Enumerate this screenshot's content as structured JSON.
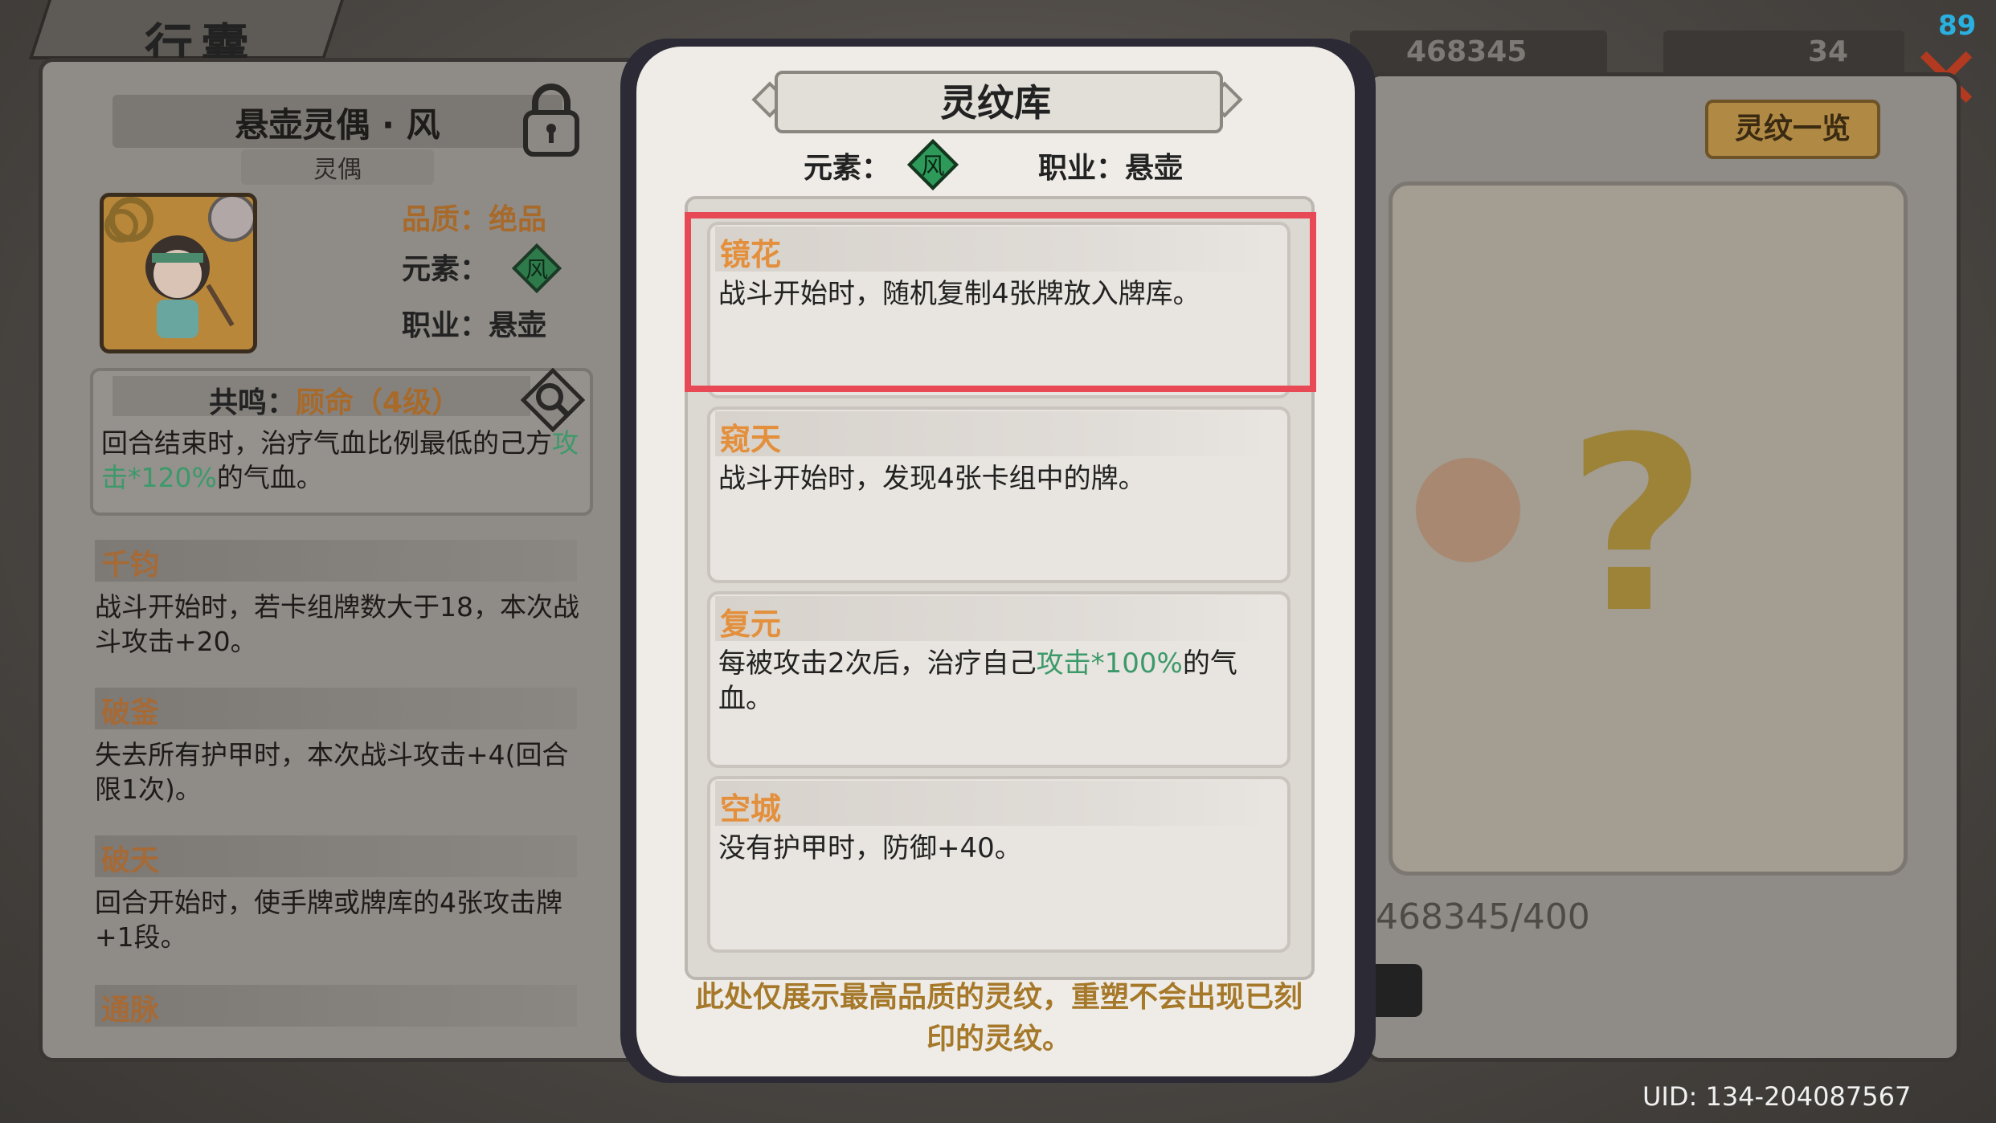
{
  "header": {
    "title": "行囊",
    "currency_1": "468345",
    "currency_2": "34",
    "level_badge": "89"
  },
  "character": {
    "name": "悬壶灵偶 · 风",
    "type": "灵偶",
    "quality_label": "品质：",
    "quality_value": "绝品",
    "element_label": "元素：",
    "element_value": "风",
    "job_label": "职业：",
    "job_value": "悬壶"
  },
  "resonance": {
    "label": "共鸣：",
    "value": "顾命（4级）",
    "desc_prefix": "回合结束时，治疗气血比例最低的己方",
    "desc_highlight": "攻击*120%",
    "desc_suffix": "的气血。"
  },
  "left_skills": [
    {
      "name": "千钧",
      "desc": "战斗开始时，若卡组牌数大于18，本次战斗攻击+20。"
    },
    {
      "name": "破釜",
      "desc": "失去所有护甲时，本次战斗攻击+4(回合限1次)。"
    },
    {
      "name": "破天",
      "desc": "回合开始时，使手牌或牌库的4张攻击牌+1段。"
    },
    {
      "name": "通脉",
      "desc": ""
    }
  ],
  "modal": {
    "title": "灵纹库",
    "element_label": "元素：",
    "element_value": "风",
    "job_label": "职业：",
    "job_value": "悬壶",
    "cards": [
      {
        "name": "镜花",
        "desc": "战斗开始时，随机复制4张牌放入牌库。",
        "desc_highlight": "",
        "desc_suffix": ""
      },
      {
        "name": "窥天",
        "desc": "战斗开始时，发现4张卡组中的牌。",
        "desc_highlight": "",
        "desc_suffix": ""
      },
      {
        "name": "复元",
        "desc": "每被攻击2次后，治疗自己",
        "desc_highlight": "攻击*100%",
        "desc_suffix": "的气血。"
      },
      {
        "name": "空城",
        "desc": "没有护甲时，防御+40。",
        "desc_highlight": "",
        "desc_suffix": ""
      }
    ],
    "footer_note": "此处仅展示最高品质的灵纹，重塑不会出现已刻印的灵纹。"
  },
  "right_panel": {
    "overview_button": "灵纹一览",
    "mystery_symbol": "?",
    "progress": "468345/400"
  },
  "footer": {
    "uid": "UID:  134-204087567"
  },
  "colors": {
    "accent_orange": "#e38f3b",
    "highlight_green": "#3c9a6a",
    "selection_red": "#e84a55",
    "wind_gem": "#2e9a5a"
  }
}
